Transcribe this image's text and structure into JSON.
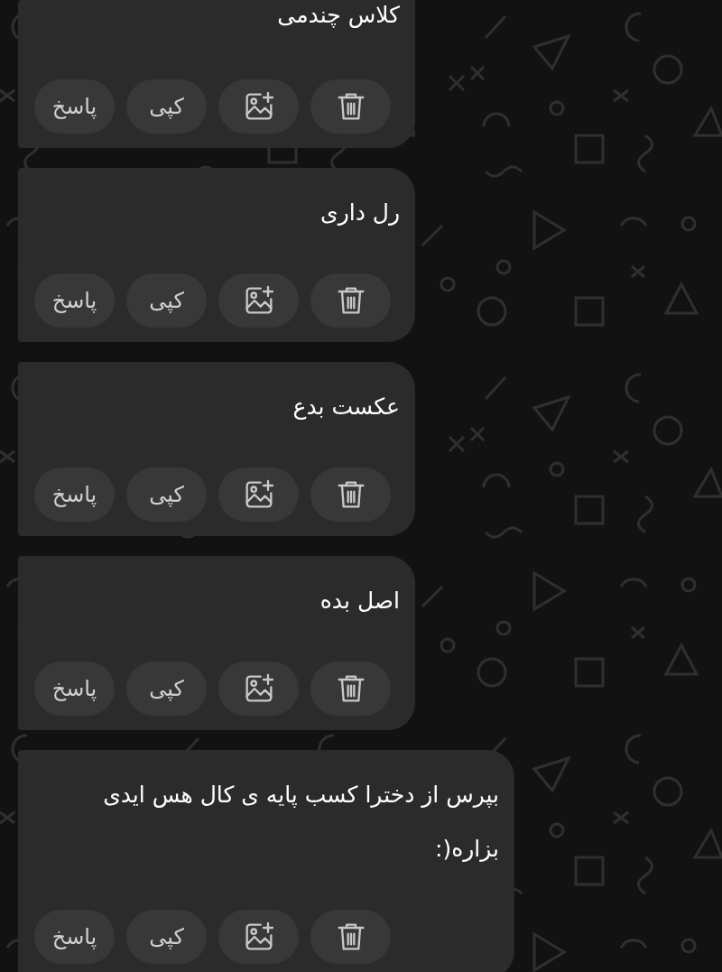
{
  "messages": [
    {
      "text": "کلاس چندمی",
      "actions": [
        {
          "kind": "delete"
        },
        {
          "kind": "image"
        },
        {
          "kind": "copy",
          "label": "کپی"
        },
        {
          "kind": "reply",
          "label": "پاسخ"
        }
      ]
    },
    {
      "text": "رل داری",
      "actions": [
        {
          "kind": "delete"
        },
        {
          "kind": "image"
        },
        {
          "kind": "copy",
          "label": "کپی"
        },
        {
          "kind": "reply",
          "label": "پاسخ"
        }
      ]
    },
    {
      "text": "عکست بدع",
      "actions": [
        {
          "kind": "delete"
        },
        {
          "kind": "image"
        },
        {
          "kind": "copy",
          "label": "کپی"
        },
        {
          "kind": "reply",
          "label": "پاسخ"
        }
      ]
    },
    {
      "text": "اصل بده",
      "actions": [
        {
          "kind": "delete"
        },
        {
          "kind": "image"
        },
        {
          "kind": "copy",
          "label": "کپی"
        },
        {
          "kind": "reply",
          "label": "پاسخ"
        }
      ]
    },
    {
      "text": "بپرس از دخترا کسب پایه ی کال هس ایدی بزاره(:",
      "actions": [
        {
          "kind": "delete"
        },
        {
          "kind": "image"
        },
        {
          "kind": "copy",
          "label": "کپی"
        },
        {
          "kind": "reply",
          "label": "پاسخ"
        }
      ]
    }
  ]
}
